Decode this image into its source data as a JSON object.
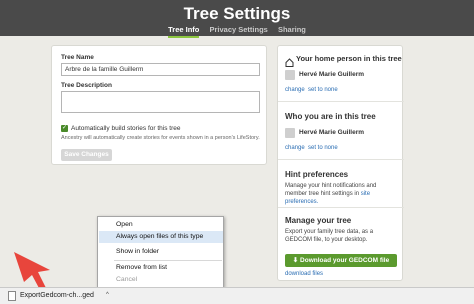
{
  "header": {
    "title": "Tree Settings",
    "tabs": [
      {
        "label": "Tree Info",
        "active": true
      },
      {
        "label": "Privacy Settings",
        "active": false
      },
      {
        "label": "Sharing",
        "active": false
      }
    ]
  },
  "tree_info": {
    "tree_name_label": "Tree Name",
    "tree_name_value": "Arbre de la famille Guillerm",
    "tree_description_label": "Tree Description",
    "tree_description_value": "",
    "auto_stories_label": "Automatically build stories for this tree",
    "auto_stories_checked": true,
    "auto_stories_note": "Ancestry will automatically create stories for events shown in a person's LifeStory.",
    "save_button": "Save Changes"
  },
  "sidebar": {
    "home_person": {
      "title": "Your home person in this tree",
      "name": "Hervé Marie Guillerm",
      "change_link": "change",
      "set_none_link": "set to none"
    },
    "you_in_tree": {
      "title": "Who you are in this tree",
      "name": "Hervé Marie Guillerm",
      "change_link": "change",
      "set_none_link": "set to none"
    },
    "hint_prefs": {
      "title": "Hint preferences",
      "text": "Manage your hint notifications and member tree hint settings in",
      "link": "site preferences."
    },
    "manage_tree": {
      "title": "Manage your tree",
      "text": "Export your family tree data, as a GEDCOM file, to your desktop.",
      "download_button": "Download your GEDCOM file",
      "download_link": "download files"
    }
  },
  "context_menu": {
    "items": [
      {
        "label": "Open",
        "state": "normal"
      },
      {
        "label": "Always open files of this type",
        "state": "hover"
      },
      {
        "label": "Show in folder",
        "state": "normal"
      },
      {
        "label": "Remove from list",
        "state": "normal"
      },
      {
        "label": "Cancel",
        "state": "disabled"
      }
    ]
  },
  "download_bar": {
    "file_name": "ExportGedcom-ch...ged",
    "caret": "^"
  },
  "colors": {
    "header_bg": "#4a4a4a",
    "active_tab_underline": "#8cc63f",
    "primary_green": "#5b9a2e",
    "link_blue": "#2a6db3",
    "annotation_arrow": "#e8453c"
  }
}
